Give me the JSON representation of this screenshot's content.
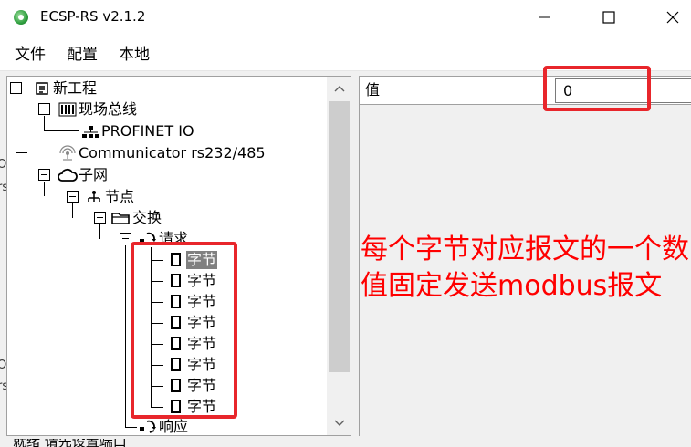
{
  "window": {
    "title": "ECSP-RS v2.1.2"
  },
  "menu": {
    "items": [
      "文件",
      "配置",
      "本地"
    ]
  },
  "tree": {
    "project": "新工程",
    "fieldbus": "现场总线",
    "profinet": "PROFINET IO",
    "communicator": "Communicator rs232/485",
    "subnet": "子网",
    "node": "节点",
    "exchange": "交换",
    "request": "请求",
    "bytes": [
      "字节",
      "字节",
      "字节",
      "字节",
      "字节",
      "字节",
      "字节",
      "字节"
    ],
    "selected_byte_index": 0,
    "response": "响应"
  },
  "properties": {
    "label": "值",
    "value": "0"
  },
  "annotation": "每个字节对应报文的一个数值固定发送modbus报文",
  "status": {
    "text": "就绪 请先设置端口"
  },
  "left_edge_glyphs": [
    "O",
    "rs",
    "O",
    "rs"
  ],
  "colors": {
    "highlight_box": "#e8262b",
    "annotation": "#ff0000",
    "selected_bg": "#808080"
  }
}
